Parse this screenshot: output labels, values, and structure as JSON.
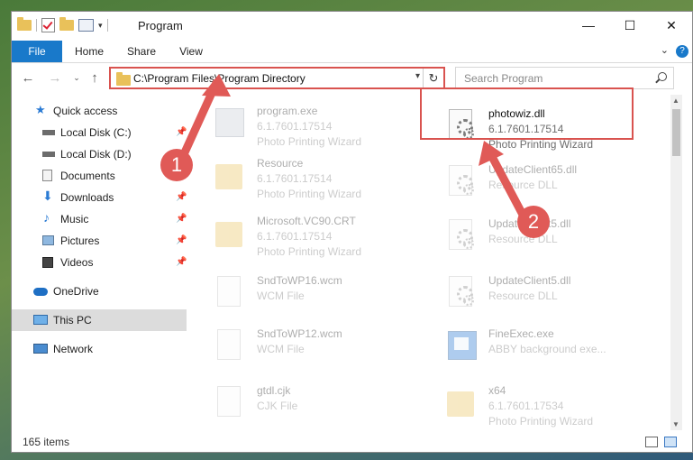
{
  "window": {
    "title": "Program"
  },
  "ribbon": {
    "tabs": [
      "File",
      "Home",
      "Share",
      "View"
    ],
    "help": "?"
  },
  "address": {
    "path": "C:\\Program Files\\Program Directory",
    "search_placeholder": "Search Program"
  },
  "sidebar": {
    "items": [
      {
        "label": "Quick access",
        "icon": "star-icon",
        "pinned": false
      },
      {
        "label": "Local Disk (C:)",
        "icon": "drive-icon",
        "pinned": true
      },
      {
        "label": "Local Disk (D:)",
        "icon": "drive-icon",
        "pinned": false
      },
      {
        "label": "Documents",
        "icon": "documents-icon",
        "pinned": true
      },
      {
        "label": "Downloads",
        "icon": "download-icon",
        "pinned": true
      },
      {
        "label": "Music",
        "icon": "music-icon",
        "pinned": true
      },
      {
        "label": "Pictures",
        "icon": "pictures-icon",
        "pinned": true
      },
      {
        "label": "Videos",
        "icon": "videos-icon",
        "pinned": true
      },
      {
        "label": "OneDrive",
        "icon": "cloud-icon",
        "pinned": false
      },
      {
        "label": "This PC",
        "icon": "computer-icon",
        "pinned": false,
        "selected": true
      },
      {
        "label": "Network",
        "icon": "network-icon",
        "pinned": false
      }
    ]
  },
  "files": [
    {
      "name": "program.exe",
      "line2": "6.1.7601.17514",
      "line3": "Photo Printing Wizard",
      "icon": "program-icon"
    },
    {
      "name": "photowiz.dll",
      "line2": "6.1.7601.17514",
      "line3": "Photo Printing Wizard",
      "icon": "dll-gear-icon",
      "highlighted": true
    },
    {
      "name": "Resource",
      "line2": "6.1.7601.17514",
      "line3": "Photo Printing Wizard",
      "icon": "folder-icon"
    },
    {
      "name": "UpdateClient65.dll",
      "line2": "Resource DLL",
      "line3": "",
      "icon": "dll-gear-icon"
    },
    {
      "name": "Microsoft.VC90.CRT",
      "line2": "6.1.7601.17514",
      "line3": "Photo Printing Wizard",
      "icon": "folder-icon"
    },
    {
      "name": "UpdateClient5.dll",
      "line2": "Resource DLL",
      "line3": "",
      "icon": "dll-gear-icon"
    },
    {
      "name": "SndToWP16.wcm",
      "line2": "WCM File",
      "line3": "",
      "icon": "file-icon"
    },
    {
      "name": "UpdateClient5.dll",
      "line2": "Resource DLL",
      "line3": "",
      "icon": "dll-gear-icon"
    },
    {
      "name": "SndToWP12.wcm",
      "line2": "WCM File",
      "line3": "",
      "icon": "file-icon"
    },
    {
      "name": "FineExec.exe",
      "line2": "ABBY background exe...",
      "line3": "",
      "icon": "exe-icon"
    },
    {
      "name": "gtdl.cjk",
      "line2": "CJK File",
      "line3": "",
      "icon": "file-icon"
    },
    {
      "name": "x64",
      "line2": "6.1.7601.17534",
      "line3": "Photo Printing Wizard",
      "icon": "folder-icon"
    }
  ],
  "status": {
    "count": "165 items"
  },
  "annotations": [
    {
      "label": "1"
    },
    {
      "label": "2"
    }
  ],
  "colors": {
    "accent": "#1979ca",
    "highlight": "#d9534f"
  }
}
